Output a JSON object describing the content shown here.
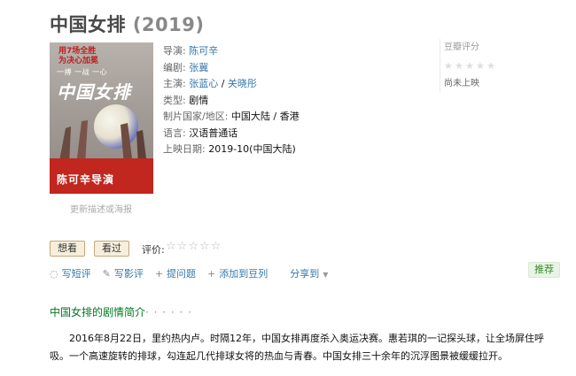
{
  "movie": {
    "title": "中国女排",
    "year": "(2019)"
  },
  "poster": {
    "headline": "用7场全胜",
    "headline2": "为决心加冕",
    "tagline": "一搏 一战 一心",
    "title": "中国女排",
    "director_text": "陈可辛导演"
  },
  "update_link": "更新描述或海报",
  "info": {
    "director_label": "导演:",
    "director": "陈可辛",
    "writer_label": "编剧:",
    "writer": "张冀",
    "cast_label": "主演:",
    "cast1": "张蓝心",
    "cast_sep": " / ",
    "cast2": "关晓彤",
    "genre_label": "类型:",
    "genre": "剧情",
    "region_label": "制片国家/地区:",
    "region": "中国大陆 / 香港",
    "language_label": "语言:",
    "language": "汉语普通话",
    "release_label": "上映日期:",
    "release": "2019-10(中国大陆)"
  },
  "rating": {
    "label": "豆瓣评分",
    "status": "尚未上映"
  },
  "user_actions": {
    "want_label": "想看",
    "seen_label": "看过",
    "rate_label": "评价:"
  },
  "actions": [
    {
      "icon": "speech-bubble-icon",
      "label": "写短评"
    },
    {
      "icon": "pencil-icon",
      "label": "写影评"
    },
    {
      "icon": "plus-icon",
      "label": "提问题"
    },
    {
      "icon": "plus-icon",
      "label": "添加到豆列"
    }
  ],
  "share": {
    "label": "分享到"
  },
  "recommend_label": "推荐",
  "summary": {
    "title": "中国女排的剧情简介",
    "dots": "· · · · · ·",
    "text": "2016年8月22日，里约热内卢。时隔12年，中国女排再度杀入奥运决赛。惠若琪的一记探头球，让全场屏住呼吸。一个高速旋转的排球，勾连起几代排球女将的热血与青春。中国女排三十余年的沉浮图景被缓缓拉开。"
  },
  "colors": {
    "link": "#3377aa",
    "summary_title": "#007722",
    "button_bg": "#f7eedc",
    "recommend_bg": "#e8f4e5"
  }
}
